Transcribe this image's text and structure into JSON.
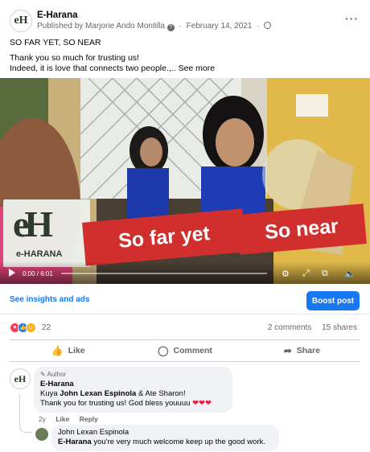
{
  "post": {
    "page_logo": "eH",
    "page_name": "E-Harana",
    "published_prefix": "Published by",
    "publisher": "Marjorie Ando Montilla",
    "date": "February 14, 2021",
    "more_icon": "···",
    "title_line": "SO FAR YET, SO NEAR",
    "line1": "Thank you so much for trusting us!",
    "line2": "Indeed, it is love that connects two people.,..",
    "see_more": "See more"
  },
  "video": {
    "time": "0:00 / 6:01",
    "banner_left": "So far yet",
    "banner_right": "So near",
    "logo_mark": "eH",
    "logo_word": "e-HARANA",
    "progress": 0
  },
  "insights": {
    "link": "See insights and ads",
    "boost_label": "Boost post"
  },
  "stats": {
    "reaction_count": "22",
    "comments": "2 comments",
    "shares": "15 shares"
  },
  "actions": {
    "like": "Like",
    "comment": "Comment",
    "share": "Share"
  },
  "comments": [
    {
      "avatar": "eH",
      "badge": "Author",
      "name": "E-Harana",
      "text_prefix": "Kuya ",
      "mentions": "John Lexan Espinola",
      "text_mid": " & Ate Sharon!",
      "text_line2": "Thank you for trusting us! God bless youuuu ",
      "hearts": "❤❤❤",
      "age": "2y",
      "like": "Like",
      "reply": "Reply"
    },
    {
      "name": "John Lexan Espinola",
      "mention": "E-Harana",
      "text": " you're very much welcome keep up the good work."
    }
  ],
  "colors": {
    "accent": "#1877f2",
    "banner": "#d12e2e",
    "muted": "#65676b"
  }
}
